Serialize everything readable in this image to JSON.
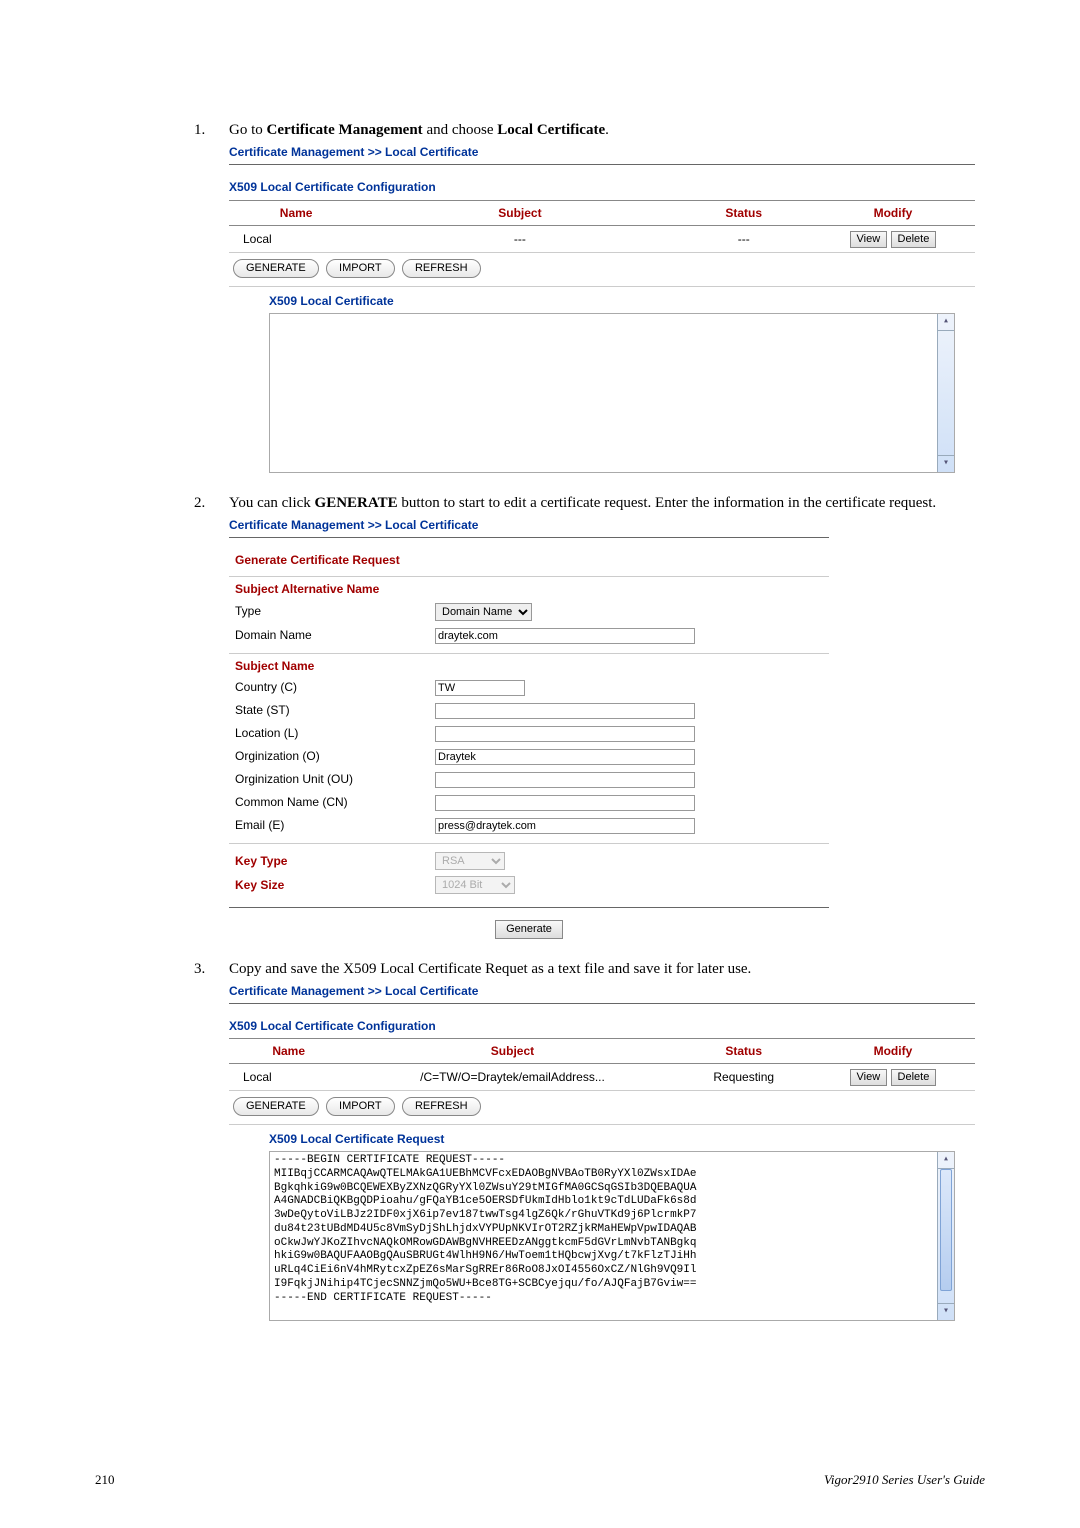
{
  "steps": {
    "s1_prefix": "Go to ",
    "s1_bold1": "Certificate Management",
    "s1_mid": " and choose ",
    "s1_bold2": "Local Certificate",
    "s1_suffix": ".",
    "s2_prefix": "You can click ",
    "s2_bold": "GENERATE",
    "s2_suffix": " button to start to edit a certificate request. Enter the information in the certificate request.",
    "s3": "Copy and save the X509 Local Certificate Requet as a text file and save it for later use."
  },
  "breadcrumb": "Certificate Management >> Local Certificate",
  "panel1": {
    "title": "X509 Local Certificate Configuration",
    "headers": {
      "name": "Name",
      "subject": "Subject",
      "status": "Status",
      "modify": "Modify"
    },
    "row": {
      "name": "Local",
      "subject": "---",
      "status": "---",
      "view": "View",
      "delete": "Delete"
    },
    "buttons": {
      "generate": "GENERATE",
      "import": "IMPORT",
      "refresh": "REFRESH"
    },
    "sub": "X509 Local Certificate"
  },
  "form": {
    "title": "Generate Certificate Request",
    "san_hdr": "Subject Alternative Name",
    "type_label": "Type",
    "type_value": "Domain Name",
    "dn_label": "Domain Name",
    "dn_value": "draytek.com",
    "sn_hdr": "Subject Name",
    "country_label": "Country (C)",
    "country_value": "TW",
    "state_label": "State (ST)",
    "state_value": "",
    "loc_label": "Location (L)",
    "loc_value": "",
    "org_label": "Orginization (O)",
    "org_value": "Draytek",
    "ou_label": "Orginization Unit (OU)",
    "ou_value": "",
    "cn_label": "Common Name (CN)",
    "cn_value": "",
    "email_label": "Email (E)",
    "email_value": "press@draytek.com",
    "kt_label": "Key Type",
    "kt_value": "RSA",
    "ks_label": "Key Size",
    "ks_value": "1024 Bit",
    "generate": "Generate"
  },
  "panel3": {
    "title": "X509 Local Certificate Configuration",
    "row": {
      "name": "Local",
      "subject": "/C=TW/O=Draytek/emailAddress...",
      "status": "Requesting",
      "view": "View",
      "delete": "Delete"
    },
    "sub": "X509 Local Certificate Request",
    "csr": "-----BEGIN CERTIFICATE REQUEST-----\nMIIBqjCCARMCAQAwQTELMAkGA1UEBhMCVFcxEDAOBgNVBAoTB0RyYXl0ZWsxIDAe\nBgkqhkiG9w0BCQEWEXByZXNzQGRyYXl0ZWsuY29tMIGfMA0GCSqGSIb3DQEBAQUA\nA4GNADCBiQKBgQDPioahu/gFQaYB1ce5OERSDfUkmIdHblo1kt9cTdLUDaFk6s8d\n3wDeQytoViLBJz2IDF0xjX6ip7ev187twwTsg4lgZ6Qk/rGhuVTKd9j6PlcrmkP7\ndu84t23tUBdMD4U5c8VmSyDjShLhjdxVYPUpNKVIrOT2RZjkRMaHEWpVpwIDAQAB\noCkwJwYJKoZIhvcNAQkOMRowGDAWBgNVHREEDzANggtkcmF5dGVrLmNvbTANBgkq\nhkiG9w0BAQUFAAOBgQAuSBRUGt4WlhH9N6/HwToem1tHQbcwjXvg/t7kFlzTJiHh\nuRLq4CiEi6nV4hMRytcxZpEZ6sMarSgRREr86RoO8JxOI4556OxCZ/NlGh9VQ9Il\nI9FqkjJNihip4TCjecSNNZjmQo5WU+Bce8TG+SCBCyejqu/fo/AJQFajB7Gviw==\n-----END CERTIFICATE REQUEST-----"
  },
  "footer": {
    "page": "210",
    "guide": "Vigor2910 Series User's Guide"
  }
}
